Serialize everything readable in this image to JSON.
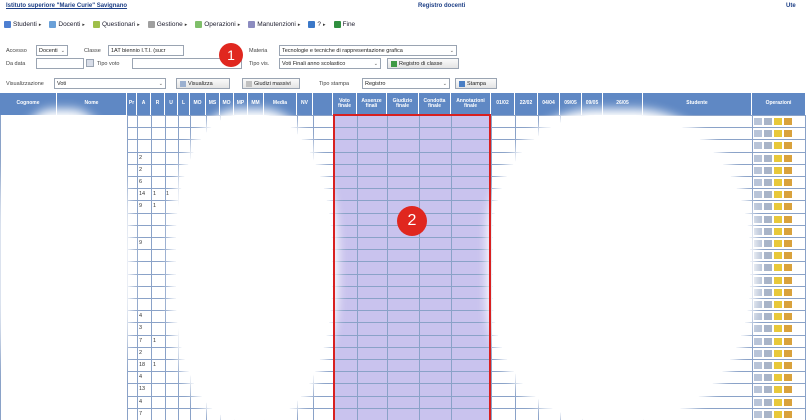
{
  "header": {
    "school": "Istituto superiore \"Marie Curie\" Savignano",
    "center_title": "Registro docenti",
    "right_label": "Ute"
  },
  "menu": [
    {
      "label": "Studenti",
      "icon": "users-icon",
      "color": "#4d7fd1"
    },
    {
      "label": "Docenti",
      "icon": "teacher-icon",
      "color": "#6aa0d8"
    },
    {
      "label": "Questionari",
      "icon": "survey-icon",
      "color": "#9fbf4a"
    },
    {
      "label": "Gestione",
      "icon": "gear-icon",
      "color": "#a0a0a0"
    },
    {
      "label": "Operazioni",
      "icon": "operations-icon",
      "color": "#7fbf6a"
    },
    {
      "label": "Manutenzioni",
      "icon": "wrench-icon",
      "color": "#8c8cc0"
    },
    {
      "label": "?",
      "icon": "help-icon",
      "color": "#3b78c8"
    },
    {
      "label": "Fine",
      "icon": "exit-icon",
      "color": "#2f8f3f"
    }
  ],
  "filters": {
    "accesso_label": "Accesso",
    "accesso_value": "Docenti",
    "classe_label": "Classe",
    "classe_value": "1AT biennio I.T.I. (sucr",
    "materia_label": "Materia",
    "materia_value": "Tecnologie e tecniche di rappresentazione grafica",
    "da_data_label": "Da data",
    "da_data_value": "",
    "tipo_voto_label": "Tipo voto",
    "tipo_voto_value": "",
    "tipo_vis_label": "Tipo vis.",
    "tipo_vis_value": "Voti Finali anno scolastico",
    "registro_classe_button": "Registro di classe",
    "visualizzazione_label": "Visualizzazione",
    "visualizzazione_value": "Voti",
    "visualizza_button": "Visualizza",
    "giudizi_button": "Giudizi massivi",
    "tipo_stampa_label": "Tipo stampa",
    "tipo_stampa_value": "Registro",
    "stampa_button": "Stampa"
  },
  "columns": [
    "Cognome",
    "Nome",
    "Pr",
    "A",
    "R",
    "U",
    "L",
    "MO",
    "MS",
    "MO",
    "MP",
    "MM",
    "Media",
    "NV",
    "Voto finale",
    "Assenze finali",
    "Giudizio finale",
    "Condotta finale",
    "Annotazioni finale",
    "01/02",
    "22/02",
    "04/04",
    "09/05",
    "09/05",
    "26/05",
    "Studente",
    "Operazioni"
  ],
  "a_values": [
    "",
    "",
    "",
    "2",
    "2",
    "6",
    "14",
    "9",
    "",
    "",
    "9",
    "",
    "",
    "",
    "",
    "",
    "4",
    "3",
    "7",
    "2",
    "18",
    "4",
    "13",
    "4",
    "7"
  ],
  "r_values": [
    "",
    "",
    "",
    "",
    "",
    "",
    "1",
    "1",
    "",
    "",
    "",
    "",
    "",
    "",
    "",
    "",
    "",
    "",
    "1",
    "",
    "1",
    "",
    "",
    "",
    ""
  ],
  "u_values": [
    "",
    "",
    "",
    "",
    "",
    "",
    "1",
    "",
    "",
    "",
    "",
    "",
    "",
    "",
    "",
    "",
    "",
    "",
    "",
    "",
    "",
    "",
    "",
    "",
    ""
  ],
  "callouts": [
    "1",
    "2"
  ],
  "colors": {
    "header_blue": "#5f88c4",
    "final_cols": "#c9c3ee",
    "highlight_red": "#d82020",
    "callout_red": "#e0271f"
  }
}
